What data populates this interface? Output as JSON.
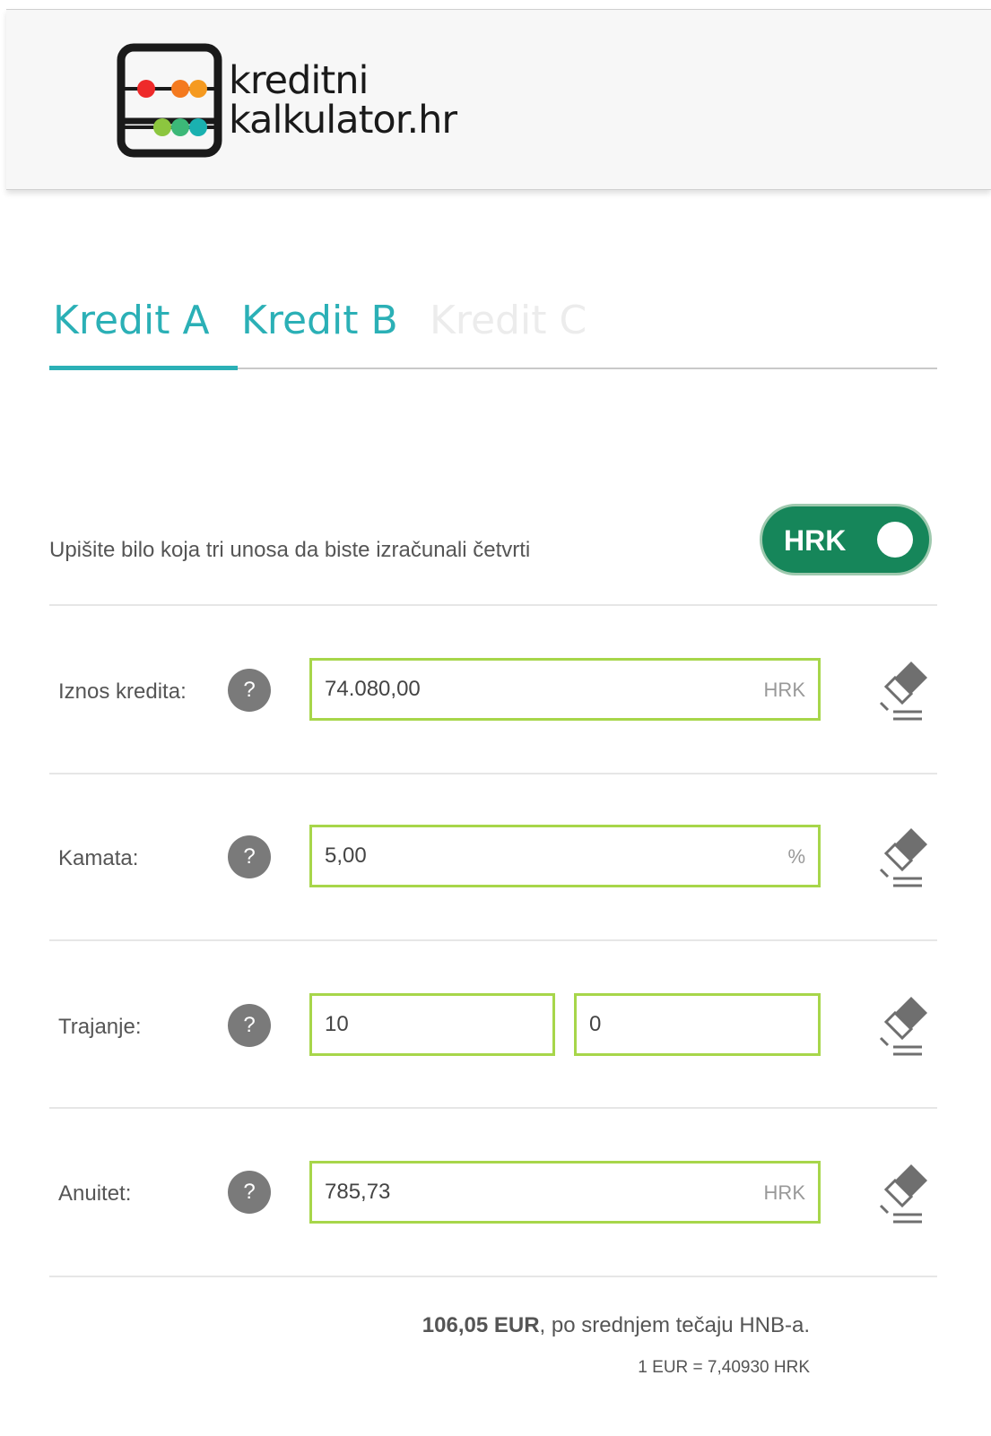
{
  "logo": {
    "line1": "kreditni",
    "line2": "kalkulator.hr"
  },
  "tabs": [
    {
      "label": "Kredit A",
      "active": true
    },
    {
      "label": "Kredit B",
      "active": false
    },
    {
      "label": "Kredit C",
      "active": false
    }
  ],
  "instruction": "Upišite bilo koja tri unosa da biste izračunali četvrti",
  "currency_toggle": {
    "label": "HRK"
  },
  "help_symbol": "?",
  "rows": {
    "amount": {
      "label": "Iznos kredita:",
      "value": "74.080,00",
      "unit": "HRK"
    },
    "interest": {
      "label": "Kamata:",
      "value": "5,00",
      "unit": "%"
    },
    "duration": {
      "label": "Trajanje:",
      "years": "10",
      "months": "0"
    },
    "annuity": {
      "label": "Anuitet:",
      "value": "785,73",
      "unit": "HRK"
    }
  },
  "footer": {
    "eur_amount": "106,05 EUR",
    "eur_suffix": ", po srednjem tečaju HNB-a.",
    "rate": "1 EUR = 7,40930 HRK"
  },
  "colors": {
    "accent": "#2bb0b6",
    "toggle_green": "#16865a",
    "field_border": "#a7d64a",
    "help_gray": "#7a7a7a"
  }
}
